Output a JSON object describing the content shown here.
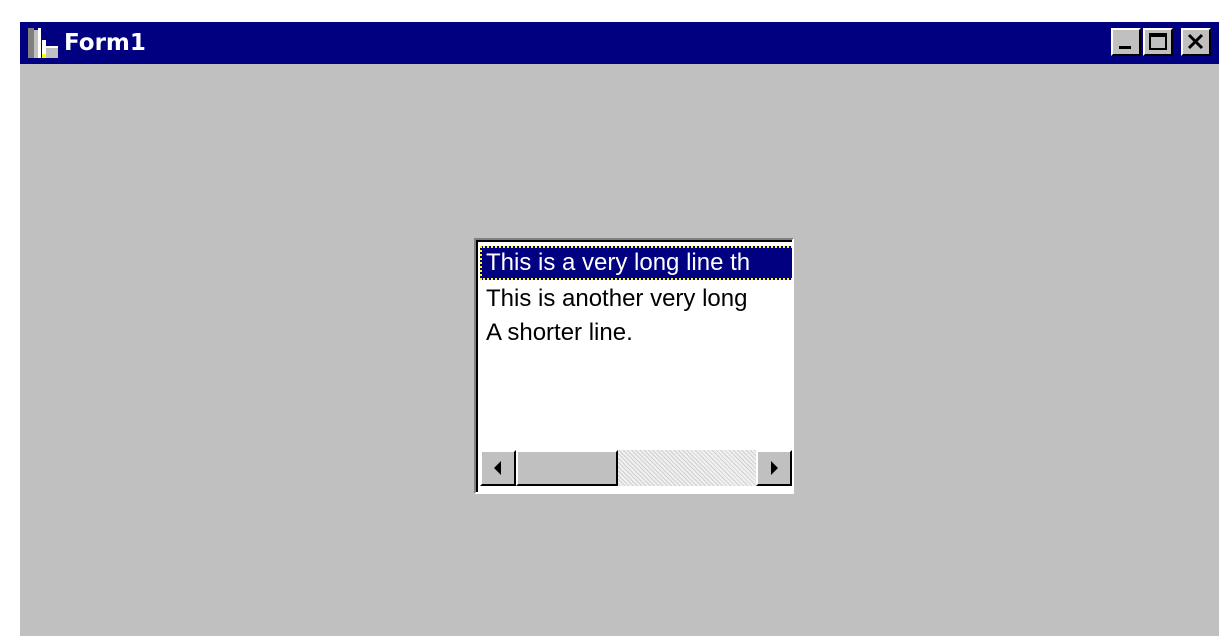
{
  "window": {
    "title": "Form1",
    "controls": {
      "minimize": "minimize-icon",
      "maximize": "maximize-icon",
      "close": "close-icon"
    }
  },
  "listbox": {
    "items": [
      {
        "text": "This is a very long line th",
        "selected": true
      },
      {
        "text": "This is another very long",
        "selected": false
      },
      {
        "text": "A shorter line.",
        "selected": false
      }
    ],
    "scrollbar": {
      "left_arrow": "left-arrow-icon",
      "right_arrow": "right-arrow-icon"
    }
  },
  "colors": {
    "titlebar": "#000080",
    "window_bg": "#c0c0c0",
    "selection_bg": "#000080",
    "selection_text": "#ffffff"
  }
}
